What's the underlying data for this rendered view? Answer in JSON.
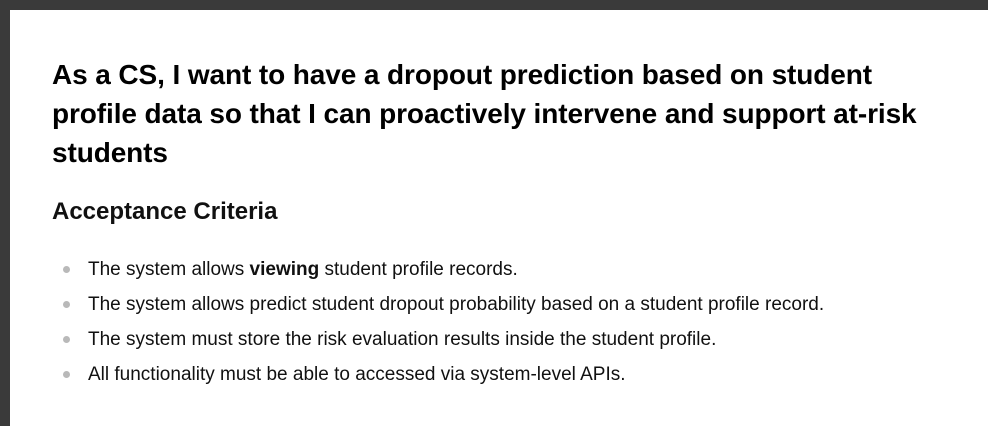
{
  "story": {
    "title": "As a CS, I want to have a dropout prediction based on student profile data so that I can proactively intervene and support at-risk students"
  },
  "acceptance": {
    "heading": "Acceptance Criteria",
    "items": [
      {
        "prefix": "The system allows ",
        "emphasis": "viewing",
        "suffix": " student profile records."
      },
      {
        "text": "The system allows predict student dropout probability based on a student profile record."
      },
      {
        "text": "The system must store the risk evaluation results inside the student profile."
      },
      {
        "text": "All functionality must be able to accessed via system-level APIs."
      }
    ]
  }
}
